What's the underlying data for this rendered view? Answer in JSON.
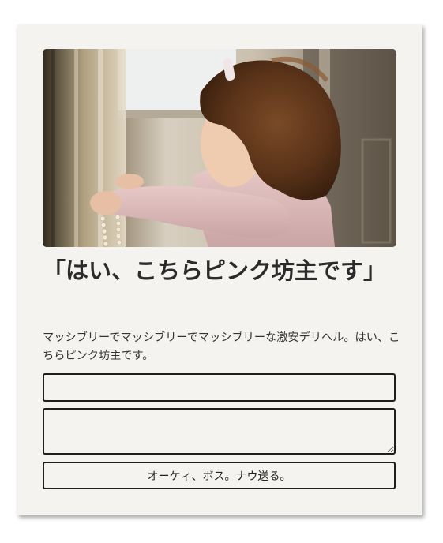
{
  "card": {
    "title": "「はい、こちらピンク坊主です」",
    "description": "マッシブリーでマッシブリーでマッシブリーな激安デリヘル。はい、こちらピンク坊主です。",
    "form": {
      "name_value": "",
      "message_value": "",
      "submit_label": "オーケィ、ボス。ナウ送る。"
    }
  },
  "colors": {
    "card_background": "#f5f3ef",
    "border": "#1e1e1e",
    "title_text": "#2b2b2b"
  }
}
